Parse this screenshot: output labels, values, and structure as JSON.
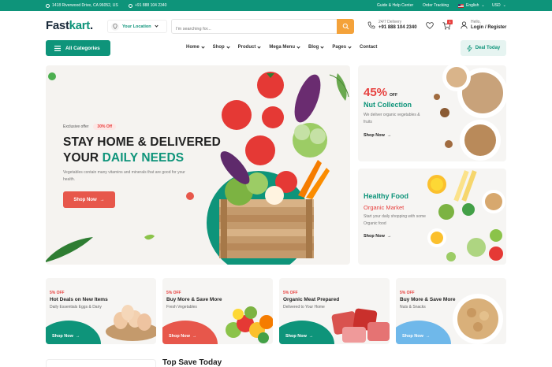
{
  "topbar": {
    "address": "1418 Riverwood Drive, CA 96052, US",
    "phone": "+91 888 104 2340",
    "guide": "Guide & Help Center",
    "order_tracking": "Order Tracking",
    "language": "English",
    "currency": "USD"
  },
  "header": {
    "logo_main": "Fast",
    "logo_accent": "kart",
    "logo_dot": ".",
    "location_label": "Your Location",
    "search_placeholder": "I'm searching for...",
    "delivery_label": "24/7 Delivery",
    "delivery_phone": "+91 888 104 2340",
    "cart_count": "1",
    "user_greeting": "Hello,",
    "user_action": "Login / Register"
  },
  "nav": {
    "all_categories": "All Categories",
    "items": [
      "Home",
      "Shop",
      "Product",
      "Mega Menu",
      "Blog",
      "Pages",
      "Contact"
    ],
    "deal_today": "Deal Today"
  },
  "hero": {
    "badge": "Exclusive offer",
    "badge_off": "30% Off",
    "title_line1": "STAY HOME & DELIVERED",
    "title_line2_a": "YOUR",
    "title_line2_b": "DAILY NEEDS",
    "description": "Vegetables contain many vitamins and minerals that are good for your health.",
    "button": "Shop Now"
  },
  "banner1": {
    "percent": "45%",
    "off": "OFF",
    "title": "Nut Collection",
    "description": "We deliver organic vegetables & fruits",
    "button": "Shop Now"
  },
  "banner2": {
    "title": "Healthy Food",
    "subtitle": "Organic Market",
    "description": "Start your daily shopping with some Organic food",
    "button": "Shop Now"
  },
  "cards": [
    {
      "percent": "5% OFF",
      "title": "Hot Deals on New Items",
      "subtitle": "Daily Essentials Eggs & Dairy",
      "button": "Shop Now",
      "color": "#0e947a"
    },
    {
      "percent": "5% OFF",
      "title": "Buy More & Save More",
      "subtitle": "Fresh Vegetables",
      "button": "Shop Now",
      "color": "#e7574b"
    },
    {
      "percent": "5% OFF",
      "title": "Organic Meat Prepared",
      "subtitle": "Delivered to Your Home",
      "button": "Shop Now",
      "color": "#0e947a"
    },
    {
      "percent": "5% OFF",
      "title": "Buy More & Save More",
      "subtitle": "Nuts & Snacks",
      "button": "Shop Now",
      "color": "#6fb8ea"
    }
  ],
  "section": {
    "top_save": "Top Save Today"
  },
  "colors": {
    "brand": "#0e947a",
    "accent_red": "#e7413f",
    "search_button": "#f4a23a"
  }
}
